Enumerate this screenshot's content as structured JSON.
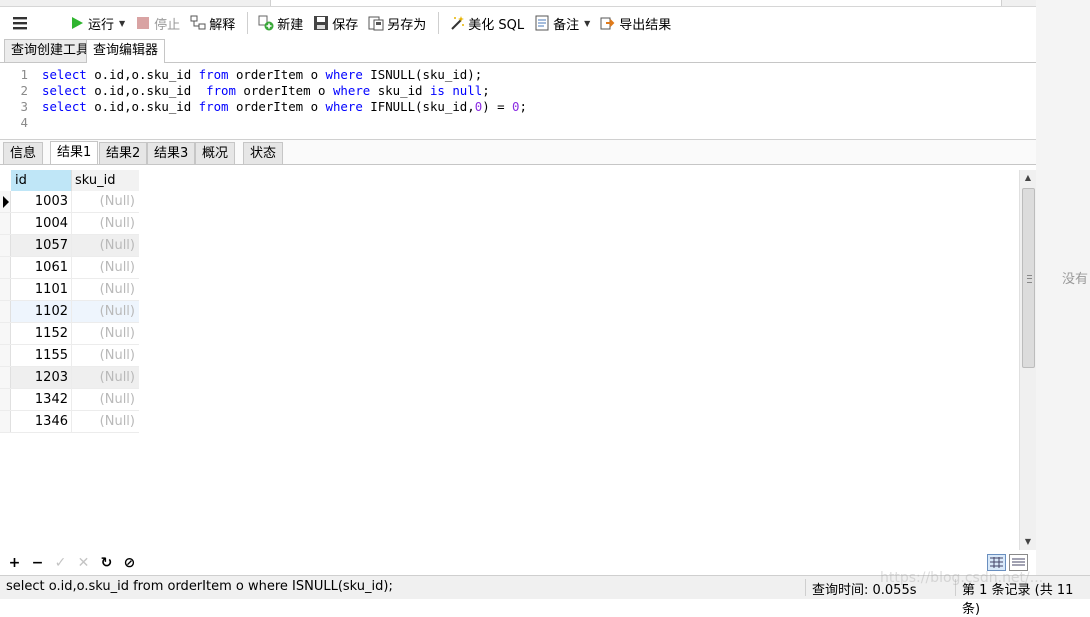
{
  "toolbar": {
    "run": "运行",
    "stop": "停止",
    "explain": "解释",
    "new": "新建",
    "save": "保存",
    "save_as": "另存为",
    "beautify": "美化 SQL",
    "notes": "备注",
    "export": "导出结果"
  },
  "query_tabs": [
    "查询创建工具",
    "查询编辑器"
  ],
  "editor": {
    "line_numbers": [
      "1",
      "2",
      "3",
      "4"
    ],
    "lines": [
      [
        {
          "t": "kw",
          "v": "select"
        },
        {
          "t": "p",
          "v": " o.id,o.sku_id "
        },
        {
          "t": "kw",
          "v": "from"
        },
        {
          "t": "p",
          "v": " orderItem o "
        },
        {
          "t": "kw",
          "v": "where"
        },
        {
          "t": "p",
          "v": " ISNULL(sku_id);"
        }
      ],
      [
        {
          "t": "kw",
          "v": "select"
        },
        {
          "t": "p",
          "v": " o.id,o.sku_id  "
        },
        {
          "t": "kw",
          "v": "from"
        },
        {
          "t": "p",
          "v": " orderItem o "
        },
        {
          "t": "kw",
          "v": "where"
        },
        {
          "t": "p",
          "v": " sku_id "
        },
        {
          "t": "kw",
          "v": "is"
        },
        {
          "t": "p",
          "v": " "
        },
        {
          "t": "kw",
          "v": "null"
        },
        {
          "t": "p",
          "v": ";"
        }
      ],
      [
        {
          "t": "kw",
          "v": "select"
        },
        {
          "t": "p",
          "v": " o.id,o.sku_id "
        },
        {
          "t": "kw",
          "v": "from"
        },
        {
          "t": "p",
          "v": " orderItem o "
        },
        {
          "t": "kw",
          "v": "where"
        },
        {
          "t": "p",
          "v": " IFNULL(sku_id,"
        },
        {
          "t": "nm",
          "v": "0"
        },
        {
          "t": "p",
          "v": ") = "
        },
        {
          "t": "nm",
          "v": "0"
        },
        {
          "t": "p",
          "v": ";"
        }
      ],
      []
    ]
  },
  "result_tabs": [
    "信息",
    "结果1",
    "结果2",
    "结果3",
    "概况",
    "状态"
  ],
  "grid": {
    "columns": [
      "id",
      "sku_id"
    ],
    "rows": [
      [
        "1003",
        "(Null)"
      ],
      [
        "1004",
        "(Null)"
      ],
      [
        "1057",
        "(Null)"
      ],
      [
        "1061",
        "(Null)"
      ],
      [
        "1101",
        "(Null)"
      ],
      [
        "1102",
        "(Null)"
      ],
      [
        "1152",
        "(Null)"
      ],
      [
        "1155",
        "(Null)"
      ],
      [
        "1203",
        "(Null)"
      ],
      [
        "1342",
        "(Null)"
      ],
      [
        "1346",
        "(Null)"
      ]
    ]
  },
  "bottom_buttons": [
    "+",
    "−",
    "✓",
    "✕",
    "↻",
    "⊘"
  ],
  "status": {
    "sql": "select o.id,o.sku_id from orderItem o where ISNULL(sku_id);",
    "query_time": "查询时间: 0.055s",
    "records": "第 1 条记录 (共 11 条)"
  },
  "side_note": "没有",
  "watermark": "https://blog.csdn.net/..."
}
